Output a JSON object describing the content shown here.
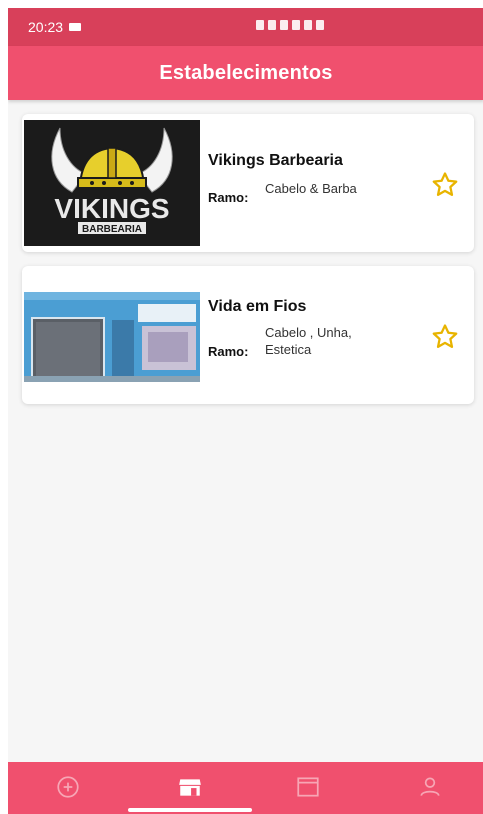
{
  "status_bar": {
    "time": "20:23"
  },
  "app_bar": {
    "title": "Estabelecimentos"
  },
  "establishments": [
    {
      "name": "Vikings Barbearia",
      "ramo_label": "Ramo:",
      "ramo_value": "Cabelo & Barba",
      "logo_text": "VIKINGS",
      "logo_subtext": "BARBEARIA",
      "favorite_icon": "star-outline-icon"
    },
    {
      "name": "Vida em Fios",
      "ramo_label": "Ramo:",
      "ramo_value": "Cabelo , Unha, Estetica",
      "favorite_icon": "star-outline-icon"
    }
  ],
  "bottom_nav": {
    "items": [
      {
        "icon": "plus-circle-icon",
        "active": false
      },
      {
        "icon": "store-icon",
        "active": true
      },
      {
        "icon": "calendar-icon",
        "active": false
      },
      {
        "icon": "person-icon",
        "active": false
      }
    ]
  },
  "colors": {
    "primary": "#f0506e",
    "status_bar": "#d8405a",
    "star": "#e8b400",
    "background": "#f6f6f6"
  }
}
